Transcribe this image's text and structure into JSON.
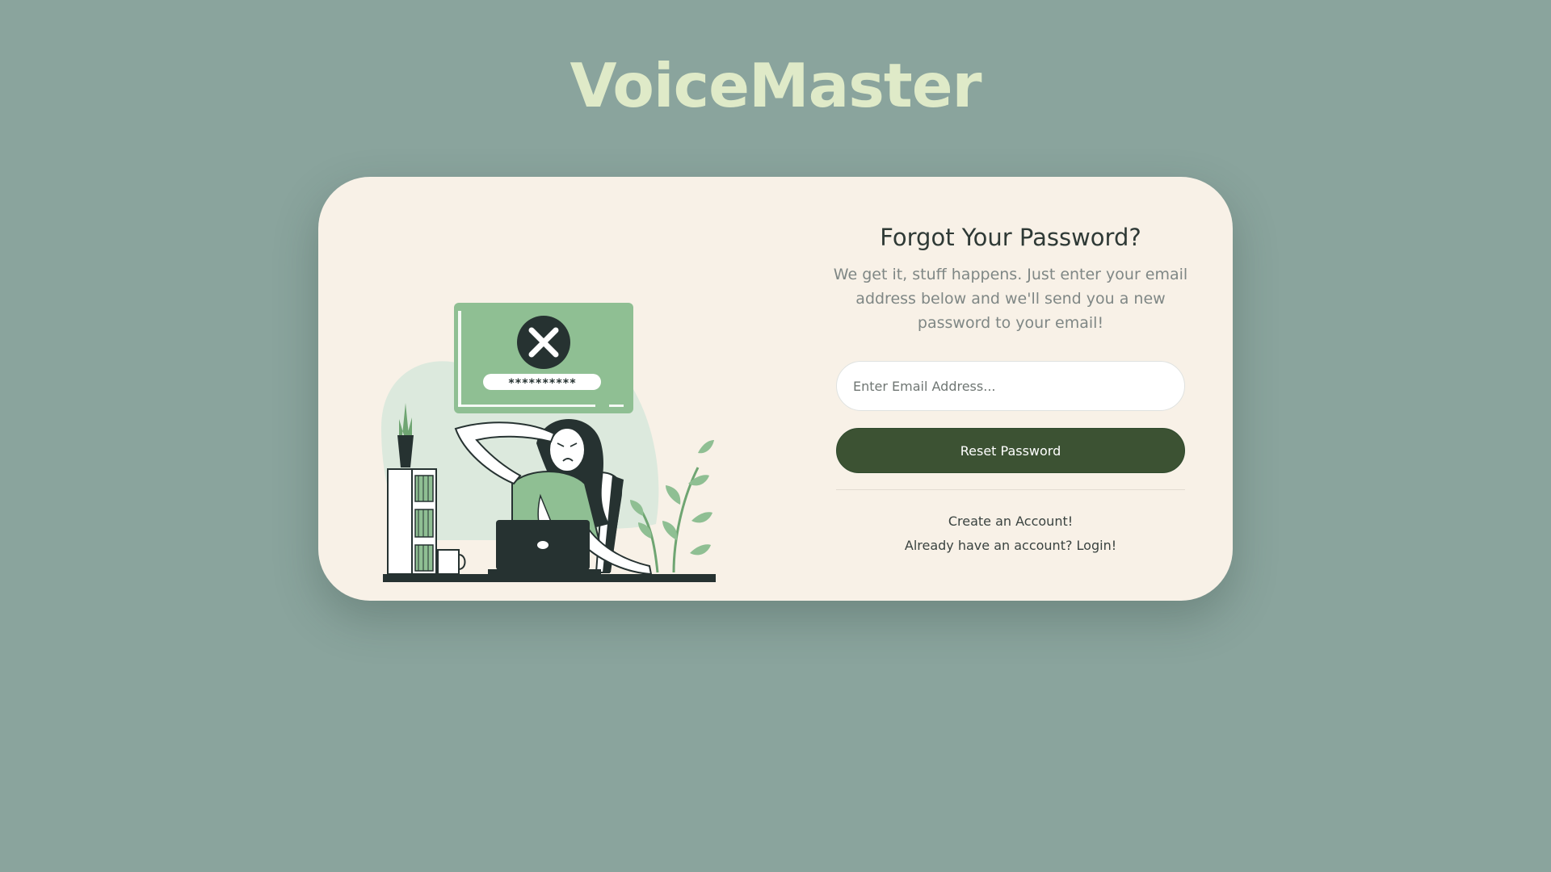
{
  "app": {
    "brand": "VoiceMaster"
  },
  "form": {
    "title": "Forgot Your Password?",
    "subtitle": "We get it, stuff happens. Just enter your email address below and we'll send you a new password to your email!",
    "email_placeholder": "Enter Email Address...",
    "email_value": "",
    "reset_label": "Reset Password"
  },
  "links": {
    "create_account": "Create an Account!",
    "login": "Already have an account? Login!"
  },
  "illustration": {
    "masked_password": "**********",
    "icon": "x-error-icon"
  },
  "colors": {
    "background": "#8aa49d",
    "brand_text": "#dfeac8",
    "card": "#f8f1e7",
    "button": "#3c5233",
    "accent_green": "#8fbf93"
  }
}
